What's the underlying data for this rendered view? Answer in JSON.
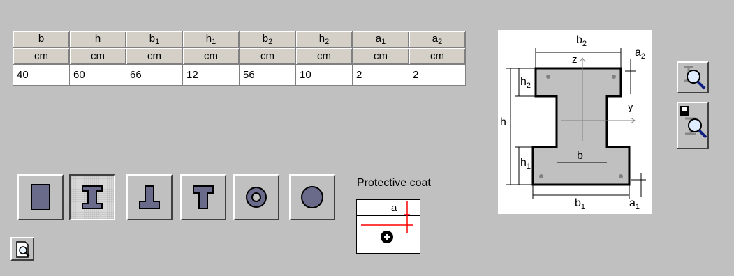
{
  "table": {
    "headers": [
      {
        "main": "b",
        "sub": ""
      },
      {
        "main": "h",
        "sub": ""
      },
      {
        "main": "b",
        "sub": "1"
      },
      {
        "main": "h",
        "sub": "1"
      },
      {
        "main": "b",
        "sub": "2"
      },
      {
        "main": "h",
        "sub": "2"
      },
      {
        "main": "a",
        "sub": "1"
      },
      {
        "main": "a",
        "sub": "2"
      }
    ],
    "units": [
      "cm",
      "cm",
      "cm",
      "cm",
      "cm",
      "cm",
      "cm",
      "cm"
    ],
    "values": [
      "40",
      "60",
      "66",
      "12",
      "56",
      "10",
      "2",
      "2"
    ]
  },
  "shapes": [
    {
      "name": "rectangle-section",
      "selected": false
    },
    {
      "name": "i-section",
      "selected": true
    },
    {
      "name": "inverted-t-section",
      "selected": false
    },
    {
      "name": "t-section",
      "selected": false
    },
    {
      "name": "ring-section",
      "selected": false
    },
    {
      "name": "circle-section",
      "selected": false
    }
  ],
  "coat": {
    "title": "Protective coat",
    "label": "a"
  },
  "diagram": {
    "b2": "b",
    "b2_sub": "2",
    "a2": "a",
    "a2_sub": "2",
    "z": "z",
    "y": "y",
    "h2": "h",
    "h2_sub": "2",
    "h": "h",
    "h1": "h",
    "h1_sub": "1",
    "b": "b",
    "b1": "b",
    "b1_sub": "1",
    "a1": "a",
    "a1_sub": "1"
  },
  "colors": {
    "section_fill": "#c0c0c0",
    "red_line": "#ff0000"
  }
}
